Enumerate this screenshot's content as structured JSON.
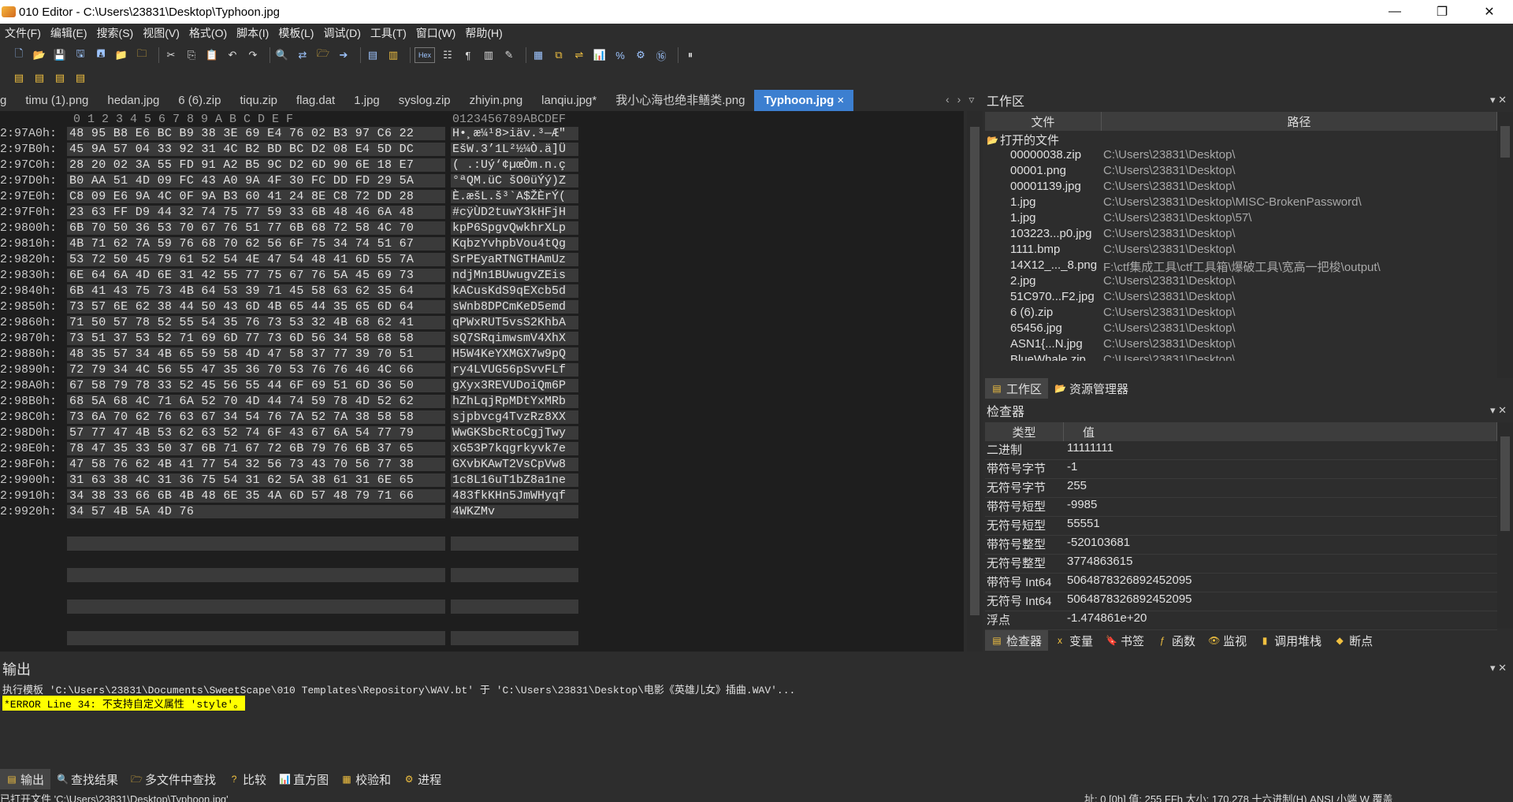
{
  "window": {
    "title": "010 Editor - C:\\Users\\23831\\Desktop\\Typhoon.jpg",
    "minimize": "—",
    "maximize": "❐",
    "close": "✕"
  },
  "menu": [
    "文件(F)",
    "编辑(E)",
    "搜索(S)",
    "视图(V)",
    "格式(O)",
    "脚本(I)",
    "模板(L)",
    "调试(D)",
    "工具(T)",
    "窗口(W)",
    "帮助(H)"
  ],
  "tabs": {
    "items": [
      "g",
      "timu (1).png",
      "hedan.jpg",
      "6 (6).zip",
      "tiqu.zip",
      "flag.dat",
      "1.jpg",
      "syslog.zip",
      "zhiyin.png",
      "lanqiu.jpg*",
      "我小心海也绝非鳝类.png"
    ],
    "active": "Typhoon.jpg",
    "active_close": "×",
    "nav": [
      "‹",
      "›",
      "▿"
    ]
  },
  "hex": {
    "header_cols": "0  1  2  3  4  5  6  7  8  9  A  B  C  D  E  F",
    "header_ascii": "0123456789ABCDEF",
    "rows": [
      {
        "addr": "2:97A0h:",
        "bytes": "48 95 B8 E6 BC B9 38 3E 69 E4 76 02 B3 97 C6 22",
        "ascii": "H•¸æ¼¹8>iäv.³—Æ\""
      },
      {
        "addr": "2:97B0h:",
        "bytes": "45 9A 57 04 33 92 31 4C B2 BD BC D2 08 E4 5D DC",
        "ascii": "EšW.3’1L²½¼Ò.ä]Ü"
      },
      {
        "addr": "2:97C0h:",
        "bytes": "28 20 02 3A 55 FD 91 A2 B5 9C D2 6D 90 6E 18 E7",
        "ascii": "( .:Uý‘¢µœÒm.n.ç"
      },
      {
        "addr": "2:97D0h:",
        "bytes": "B0 AA 51 4D 09 FC 43 A0 9A 4F 30 FC DD FD 29 5A",
        "ascii": "°ªQM.üC šO0üÝý)Z"
      },
      {
        "addr": "2:97E0h:",
        "bytes": "C8 09 E6 9A 4C 0F 9A B3 60 41 24 8E C8 72 DD 28",
        "ascii": "È.æšL.š³`A$ŽÈrÝ("
      },
      {
        "addr": "2:97F0h:",
        "bytes": "23 63 FF D9 44 32 74 75 77 59 33 6B 48 46 6A 48",
        "ascii": "#cÿÙD2tuwY3kHFjH"
      },
      {
        "addr": "2:9800h:",
        "bytes": "6B 70 50 36 53 70 67 76 51 77 6B 68 72 58 4C 70",
        "ascii": "kpP6SpgvQwkhrXLp"
      },
      {
        "addr": "2:9810h:",
        "bytes": "4B 71 62 7A 59 76 68 70 62 56 6F 75 34 74 51 67",
        "ascii": "KqbzYvhpbVou4tQg"
      },
      {
        "addr": "2:9820h:",
        "bytes": "53 72 50 45 79 61 52 54 4E 47 54 48 41 6D 55 7A",
        "ascii": "SrPEyaRTNGTHAmUz"
      },
      {
        "addr": "2:9830h:",
        "bytes": "6E 64 6A 4D 6E 31 42 55 77 75 67 76 5A 45 69 73",
        "ascii": "ndjMn1BUwugvZEis"
      },
      {
        "addr": "2:9840h:",
        "bytes": "6B 41 43 75 73 4B 64 53 39 71 45 58 63 62 35 64",
        "ascii": "kACusKdS9qEXcb5d"
      },
      {
        "addr": "2:9850h:",
        "bytes": "73 57 6E 62 38 44 50 43 6D 4B 65 44 35 65 6D 64",
        "ascii": "sWnb8DPCmKeD5emd"
      },
      {
        "addr": "2:9860h:",
        "bytes": "71 50 57 78 52 55 54 35 76 73 53 32 4B 68 62 41",
        "ascii": "qPWxRUT5vsS2KhbA"
      },
      {
        "addr": "2:9870h:",
        "bytes": "73 51 37 53 52 71 69 6D 77 73 6D 56 34 58 68 58",
        "ascii": "sQ7SRqimwsmV4XhX"
      },
      {
        "addr": "2:9880h:",
        "bytes": "48 35 57 34 4B 65 59 58 4D 47 58 37 77 39 70 51",
        "ascii": "H5W4KeYXMGX7w9pQ"
      },
      {
        "addr": "2:9890h:",
        "bytes": "72 79 34 4C 56 55 47 35 36 70 53 76 76 46 4C 66",
        "ascii": "ry4LVUG56pSvvFLf"
      },
      {
        "addr": "2:98A0h:",
        "bytes": "67 58 79 78 33 52 45 56 55 44 6F 69 51 6D 36 50",
        "ascii": "gXyx3REVUDoiQm6P"
      },
      {
        "addr": "2:98B0h:",
        "bytes": "68 5A 68 4C 71 6A 52 70 4D 44 74 59 78 4D 52 62",
        "ascii": "hZhLqjRpMDtYxMRb"
      },
      {
        "addr": "2:98C0h:",
        "bytes": "73 6A 70 62 76 63 67 34 54 76 7A 52 7A 38 58 58",
        "ascii": "sjpbvcg4TvzRz8XX"
      },
      {
        "addr": "2:98D0h:",
        "bytes": "57 77 47 4B 53 62 63 52 74 6F 43 67 6A 54 77 79",
        "ascii": "WwGKSbcRtoCgjTwy"
      },
      {
        "addr": "2:98E0h:",
        "bytes": "78 47 35 33 50 37 6B 71 67 72 6B 79 76 6B 37 65",
        "ascii": "xG53P7kqgrkyvk7e"
      },
      {
        "addr": "2:98F0h:",
        "bytes": "47 58 76 62 4B 41 77 54 32 56 73 43 70 56 77 38",
        "ascii": "GXvbKAwT2VsCpVw8"
      },
      {
        "addr": "2:9900h:",
        "bytes": "31 63 38 4C 31 36 75 54 31 62 5A 38 61 31 6E 65",
        "ascii": "1c8L16uT1bZ8a1ne"
      },
      {
        "addr": "2:9910h:",
        "bytes": "34 38 33 66 6B 4B 48 6E 35 4A 6D 57 48 79 71 66",
        "ascii": "483fkKHn5JmWHyqf"
      },
      {
        "addr": "2:9920h:",
        "bytes": "34 57 4B 5A 4D 76",
        "ascii": "4WKZMv"
      }
    ]
  },
  "workspace": {
    "title": "工作区",
    "col_file": "文件",
    "col_path": "路径",
    "group": "打开的文件",
    "files": [
      {
        "name": "00000038.zip",
        "path": "C:\\Users\\23831\\Desktop\\"
      },
      {
        "name": "00001.png",
        "path": "C:\\Users\\23831\\Desktop\\"
      },
      {
        "name": "00001139.jpg",
        "path": "C:\\Users\\23831\\Desktop\\"
      },
      {
        "name": "1.jpg",
        "path": "C:\\Users\\23831\\Desktop\\MISC-BrokenPassword\\"
      },
      {
        "name": "1.jpg",
        "path": "C:\\Users\\23831\\Desktop\\57\\"
      },
      {
        "name": "103223...p0.jpg",
        "path": "C:\\Users\\23831\\Desktop\\"
      },
      {
        "name": "1111.bmp",
        "path": "C:\\Users\\23831\\Desktop\\"
      },
      {
        "name": "14X12_..._8.png",
        "path": "F:\\ctf集成工具\\ctf工具箱\\爆破工具\\宽高一把梭\\output\\"
      },
      {
        "name": "2.jpg",
        "path": "C:\\Users\\23831\\Desktop\\"
      },
      {
        "name": "51C970...F2.jpg",
        "path": "C:\\Users\\23831\\Desktop\\"
      },
      {
        "name": "6 (6).zip",
        "path": "C:\\Users\\23831\\Desktop\\"
      },
      {
        "name": "65456.jpg",
        "path": "C:\\Users\\23831\\Desktop\\"
      },
      {
        "name": "ASN1{...N.jpg",
        "path": "C:\\Users\\23831\\Desktop\\"
      },
      {
        "name": "BlueWhale.zip",
        "path": "C:\\Users\\23831\\Desktop\\"
      }
    ],
    "subtab_workspace": "工作区",
    "subtab_explorer": "资源管理器"
  },
  "inspector": {
    "title": "检查器",
    "col_type": "类型",
    "col_value": "值",
    "rows": [
      {
        "type": "二进制",
        "value": "11111111"
      },
      {
        "type": "带符号字节",
        "value": "-1"
      },
      {
        "type": "无符号字节",
        "value": "255"
      },
      {
        "type": "带符号短型",
        "value": "-9985"
      },
      {
        "type": "无符号短型",
        "value": "55551"
      },
      {
        "type": "带符号整型",
        "value": "-520103681"
      },
      {
        "type": "无符号整型",
        "value": "3774863615"
      },
      {
        "type": "带符号 Int64",
        "value": "5064878326892452095"
      },
      {
        "type": "无符号 Int64",
        "value": "5064878326892452095"
      },
      {
        "type": "浮点",
        "value": "-1.474861e+20"
      }
    ],
    "tabs": [
      "检查器",
      "变量",
      "书签",
      "函数",
      "监视",
      "调用堆栈",
      "断点"
    ]
  },
  "output": {
    "title": "输出",
    "line1": "执行模板 'C:\\Users\\23831\\Documents\\SweetScape\\010 Templates\\Repository\\WAV.bt' 于 'C:\\Users\\23831\\Desktop\\电影《英雄儿女》插曲.WAV'...",
    "line2": "*ERROR Line 34: 不支持自定义属性 'style'。",
    "tabs": [
      "输出",
      "查找结果",
      "多文件中查找",
      "比较",
      "直方图",
      "校验和",
      "进程"
    ]
  },
  "status": {
    "left": "已打开文件 'C:\\Users\\23831\\Desktop\\Typhoon.jpg'",
    "right": "址: 0 [0h]  值: 255 FFh   大小: 170,278      十六进制(H)  ANSI  小端      W  覆盖"
  },
  "panel_ctl": "▾ ✕"
}
